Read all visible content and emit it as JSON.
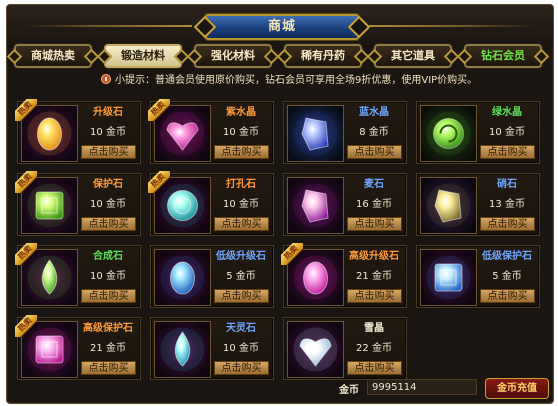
{
  "window": {
    "title": "商城"
  },
  "tabs": [
    {
      "label": "商城热卖",
      "active": false
    },
    {
      "label": "锻造材料",
      "active": true
    },
    {
      "label": "强化材料",
      "active": false
    },
    {
      "label": "稀有丹药",
      "active": false
    },
    {
      "label": "其它道具",
      "active": false
    },
    {
      "label": "钻石会员",
      "active": false
    }
  ],
  "notice": {
    "icon": "info-icon",
    "text": "小提示：普通会员使用原价购买，钻石会员可享用全场9折优惠，使用VIP价购买。"
  },
  "items": [
    {
      "name": "升级石",
      "price": "10 金币",
      "buy": "点击购买",
      "hot": true,
      "hot_label": "热卖",
      "icon": "yellow-oval-gem-icon",
      "name_color": "#ff9a3c"
    },
    {
      "name": "紫水晶",
      "price": "10 金币",
      "buy": "点击购买",
      "hot": true,
      "hot_label": "热卖",
      "icon": "purple-heart-gem-icon",
      "name_color": "#ff9a3c"
    },
    {
      "name": "蓝水晶",
      "price": "8 金币",
      "buy": "点击购买",
      "hot": false,
      "icon": "blue-crystal-gem-icon",
      "name_color": "#6fa7ff"
    },
    {
      "name": "绿水晶",
      "price": "10 金币",
      "buy": "点击购买",
      "hot": false,
      "icon": "green-spiral-gem-icon",
      "name_color": "#5be05b"
    },
    {
      "name": "保护石",
      "price": "10 金币",
      "buy": "点击购买",
      "hot": true,
      "hot_label": "热卖",
      "icon": "green-square-gem-icon",
      "name_color": "#ff9a3c"
    },
    {
      "name": "打孔石",
      "price": "10 金币",
      "buy": "点击购买",
      "hot": true,
      "hot_label": "热卖",
      "icon": "cyan-round-gem-icon",
      "name_color": "#ff9a3c"
    },
    {
      "name": "麦石",
      "price": "16 金币",
      "buy": "点击购买",
      "hot": false,
      "icon": "violet-shard-gem-icon",
      "name_color": "#6fa7ff"
    },
    {
      "name": "硝石",
      "price": "13 金币",
      "buy": "点击购买",
      "hot": false,
      "icon": "gold-shard-gem-icon",
      "name_color": "#6fa7ff"
    },
    {
      "name": "合成石",
      "price": "10 金币",
      "buy": "点击购买",
      "hot": true,
      "hot_label": "热卖",
      "icon": "green-drop-gem-icon",
      "name_color": "#5be05b"
    },
    {
      "name": "低级升级石",
      "price": "5 金币",
      "buy": "点击购买",
      "hot": false,
      "icon": "blue-oval-gem-icon",
      "name_color": "#6fa7ff"
    },
    {
      "name": "高级升级石",
      "price": "21 金币",
      "buy": "点击购买",
      "hot": true,
      "hot_label": "热卖",
      "icon": "pink-oval-gem-icon",
      "name_color": "#ff9a3c"
    },
    {
      "name": "低级保护石",
      "price": "5 金币",
      "buy": "点击购买",
      "hot": false,
      "icon": "blue-square-gem-icon",
      "name_color": "#6fa7ff"
    },
    {
      "name": "高级保护石",
      "price": "21 金币",
      "buy": "点击购买",
      "hot": true,
      "hot_label": "热卖",
      "icon": "pink-square-gem-icon",
      "name_color": "#ff9a3c"
    },
    {
      "name": "天灵石",
      "price": "10 金币",
      "buy": "点击购买",
      "hot": false,
      "icon": "cyan-drop-gem-icon",
      "name_color": "#6fa7ff"
    },
    {
      "name": "雪晶",
      "price": "22 金币",
      "buy": "点击购买",
      "hot": false,
      "icon": "white-heart-gem-icon",
      "name_color": "#f2ead2"
    }
  ],
  "footer": {
    "gold_label": "金币",
    "gold_value": "9995114",
    "recharge_label": "金币充值"
  }
}
